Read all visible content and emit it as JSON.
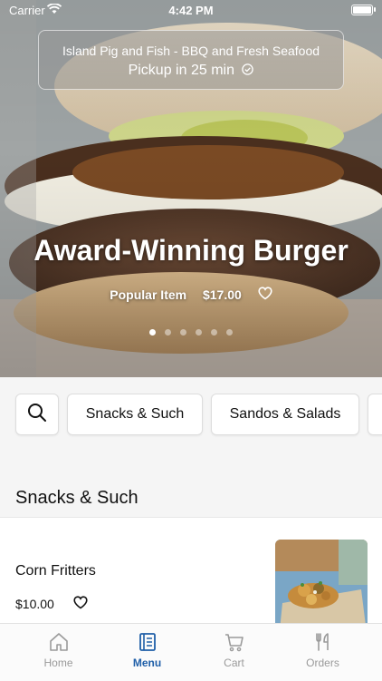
{
  "status_bar": {
    "carrier": "Carrier",
    "time": "4:42 PM"
  },
  "restaurant": {
    "name": "Island Pig and Fish - BBQ and Fresh Seafood",
    "pickup": "Pickup in 25 min"
  },
  "featured": {
    "title": "Award-Winning Burger",
    "tag": "Popular Item",
    "price": "$17.00",
    "carousel_count": 6,
    "carousel_active_index": 0
  },
  "categories": [
    "Snacks & Such",
    "Sandos & Salads",
    ""
  ],
  "section": {
    "title": "Snacks & Such"
  },
  "items": [
    {
      "name": "Corn Fritters",
      "price": "$10.00"
    }
  ],
  "tabs": [
    {
      "label": "Home",
      "icon": "home-icon",
      "active": false
    },
    {
      "label": "Menu",
      "icon": "menu-icon",
      "active": true
    },
    {
      "label": "Cart",
      "icon": "cart-icon",
      "active": false
    },
    {
      "label": "Orders",
      "icon": "utensils-icon",
      "active": false
    }
  ],
  "colors": {
    "accent": "#1f5fa8",
    "inactive_tab": "#9a9a9a"
  }
}
